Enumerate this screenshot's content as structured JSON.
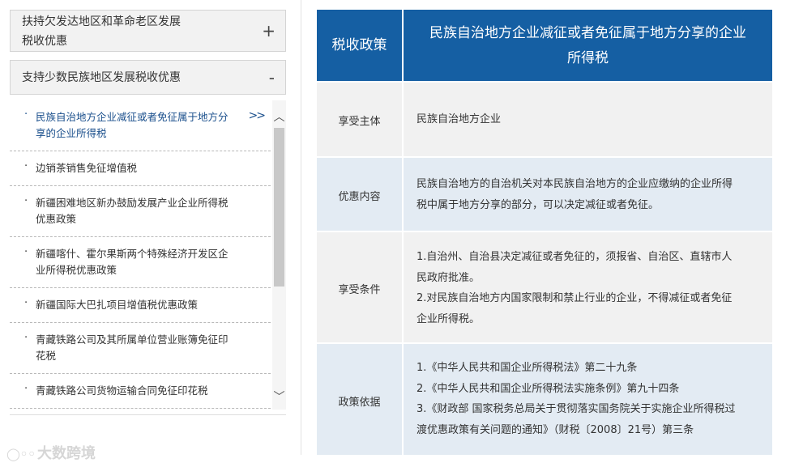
{
  "sidebar": {
    "accordion": [
      {
        "label": "扶持欠发达地区和革命老区发展税收优惠",
        "label_lines": [
          "扶持欠发达地区和革命老区发展",
          "税收优惠"
        ],
        "sign": "+"
      },
      {
        "label": "支持少数民族地区发展税收优惠",
        "sign": "-"
      }
    ],
    "items": [
      {
        "label_lines": [
          "民族自治地方企业减征或者免征属于地方分",
          "享的企业所得税"
        ],
        "arrow": ">>"
      },
      {
        "label_lines": [
          "边销茶销售免征增值税"
        ]
      },
      {
        "label_lines": [
          "新疆困难地区新办鼓励发展产业企业所得税",
          "优惠政策"
        ]
      },
      {
        "label_lines": [
          "新疆喀什、霍尔果斯两个特殊经济开发区企",
          "业所得税优惠政策"
        ]
      },
      {
        "label_lines": [
          "新疆国际大巴扎项目增值税优惠政策"
        ]
      },
      {
        "label_lines": [
          "青藏铁路公司及其所属单位营业账簿免征印",
          "花税"
        ]
      },
      {
        "label_lines": [
          "青藏铁路公司货物运输合同免征印花税"
        ]
      }
    ],
    "bullet": "·",
    "scroll_up": "︿",
    "scroll_down": "﹀"
  },
  "table": {
    "header": {
      "left": "税收政策",
      "right_lines": [
        "民族自治地方企业减征或者免征属于地方分享的企业",
        "所得税"
      ]
    },
    "rows": [
      {
        "label": "享受主体",
        "lines": [
          "民族自治地方企业"
        ]
      },
      {
        "label": "优惠内容",
        "lines": [
          "民族自治地方的自治机关对本民族自治地方的企业应缴纳的企业所得",
          "税中属于地方分享的部分，可以决定减征或者免征。"
        ]
      },
      {
        "label": "享受条件",
        "lines": [
          "1.自治州、自治县决定减征或者免征的，须报省、自治区、直辖市人",
          "民政府批准。",
          "2.对民族自治地方内国家限制和禁止行业的企业，不得减征或者免征",
          "企业所得税。"
        ]
      },
      {
        "label": "政策依据",
        "lines": [
          "1.《中华人民共和国企业所得税法》第二十九条",
          "2.《中华人民共和国企业所得税法实施条例》第九十四条",
          "3.《财政部 国家税务总局关于贯彻落实国务院关于实施企业所得税过",
          "渡优惠政策有关问题的通知》（财税〔2008〕21号）第三条"
        ]
      }
    ]
  },
  "watermark": {
    "text": "大数跨境"
  },
  "colors": {
    "header_blue": "#155fa3",
    "active_link": "#1a4f8c",
    "row_gray": "#f1f1f1",
    "row_blue": "#e3ebf3"
  }
}
